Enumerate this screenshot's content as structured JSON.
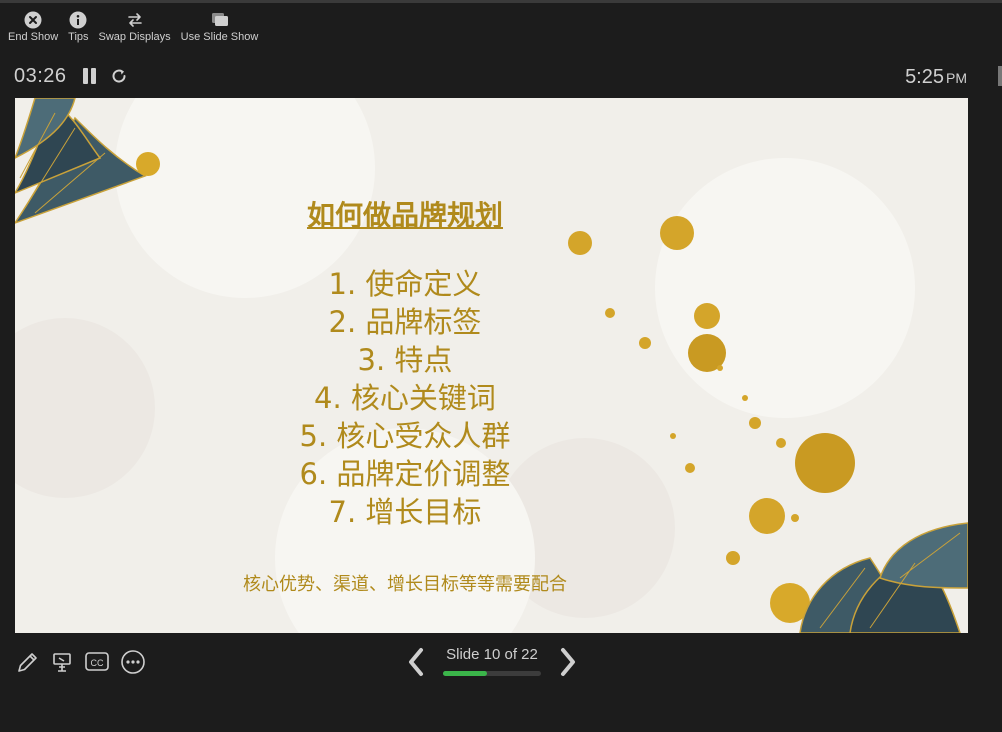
{
  "toolbar": {
    "end_show": "End Show",
    "tips": "Tips",
    "swap_displays": "Swap Displays",
    "use_slide_show": "Use Slide Show"
  },
  "status": {
    "elapsed": "03:26",
    "clock_time": "5:25",
    "clock_ampm": "PM"
  },
  "slide": {
    "title": "如何做品牌规划",
    "items": [
      "1.  使命定义",
      "2.  品牌标签",
      "3.  特点",
      "4.  核心关键词",
      "5.  核心受众人群",
      "6.  品牌定价调整",
      "7.  增长目标"
    ],
    "note": "核心优势、渠道、增长目标等等需要配合"
  },
  "navigation": {
    "slide_label": "Slide 10 of 22",
    "current": 10,
    "total": 22,
    "progress": 0.45
  },
  "colors": {
    "accent_gold": "#b08a1c",
    "progress_green": "#3bb54a",
    "background": "#1c1c1c"
  },
  "icons": [
    "close-icon",
    "info-icon",
    "swap-icon",
    "slideshow-icon",
    "pause-icon",
    "reset-icon",
    "pen-icon",
    "laser-pointer-icon",
    "captions-icon",
    "more-icon",
    "chevron-left-icon",
    "chevron-right-icon"
  ]
}
